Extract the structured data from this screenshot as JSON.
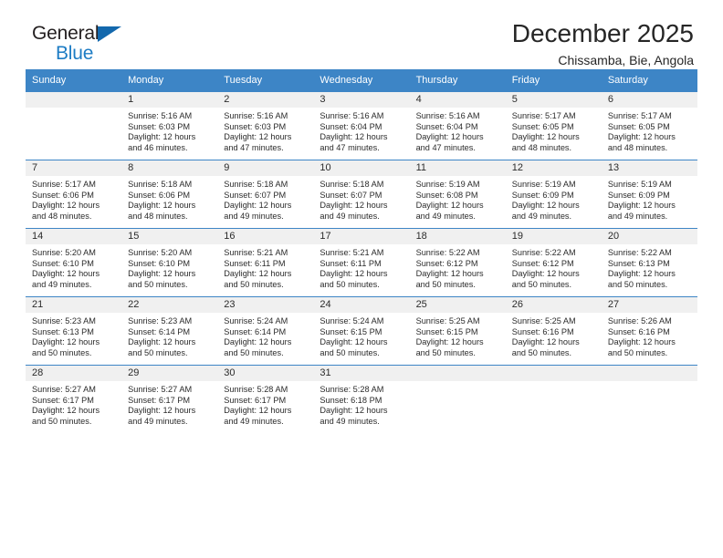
{
  "brand": {
    "line1": "General",
    "line2": "Blue",
    "triangle_color": "#1368ad",
    "blue_text_color": "#1d7cc4"
  },
  "header": {
    "title": "December 2025",
    "subtitle": "Chissamba, Bie, Angola"
  },
  "theme": {
    "header_blue": "#3d85c6",
    "daynum_band": "#f0f0f0",
    "text": "#2b2b2b"
  },
  "weekday_headers": [
    "Sunday",
    "Monday",
    "Tuesday",
    "Wednesday",
    "Thursday",
    "Friday",
    "Saturday"
  ],
  "weeks": [
    [
      {
        "day": "",
        "sunrise": "",
        "sunset": "",
        "daylight1": "",
        "daylight2": ""
      },
      {
        "day": "1",
        "sunrise": "Sunrise: 5:16 AM",
        "sunset": "Sunset: 6:03 PM",
        "daylight1": "Daylight: 12 hours",
        "daylight2": "and 46 minutes."
      },
      {
        "day": "2",
        "sunrise": "Sunrise: 5:16 AM",
        "sunset": "Sunset: 6:03 PM",
        "daylight1": "Daylight: 12 hours",
        "daylight2": "and 47 minutes."
      },
      {
        "day": "3",
        "sunrise": "Sunrise: 5:16 AM",
        "sunset": "Sunset: 6:04 PM",
        "daylight1": "Daylight: 12 hours",
        "daylight2": "and 47 minutes."
      },
      {
        "day": "4",
        "sunrise": "Sunrise: 5:16 AM",
        "sunset": "Sunset: 6:04 PM",
        "daylight1": "Daylight: 12 hours",
        "daylight2": "and 47 minutes."
      },
      {
        "day": "5",
        "sunrise": "Sunrise: 5:17 AM",
        "sunset": "Sunset: 6:05 PM",
        "daylight1": "Daylight: 12 hours",
        "daylight2": "and 48 minutes."
      },
      {
        "day": "6",
        "sunrise": "Sunrise: 5:17 AM",
        "sunset": "Sunset: 6:05 PM",
        "daylight1": "Daylight: 12 hours",
        "daylight2": "and 48 minutes."
      }
    ],
    [
      {
        "day": "7",
        "sunrise": "Sunrise: 5:17 AM",
        "sunset": "Sunset: 6:06 PM",
        "daylight1": "Daylight: 12 hours",
        "daylight2": "and 48 minutes."
      },
      {
        "day": "8",
        "sunrise": "Sunrise: 5:18 AM",
        "sunset": "Sunset: 6:06 PM",
        "daylight1": "Daylight: 12 hours",
        "daylight2": "and 48 minutes."
      },
      {
        "day": "9",
        "sunrise": "Sunrise: 5:18 AM",
        "sunset": "Sunset: 6:07 PM",
        "daylight1": "Daylight: 12 hours",
        "daylight2": "and 49 minutes."
      },
      {
        "day": "10",
        "sunrise": "Sunrise: 5:18 AM",
        "sunset": "Sunset: 6:07 PM",
        "daylight1": "Daylight: 12 hours",
        "daylight2": "and 49 minutes."
      },
      {
        "day": "11",
        "sunrise": "Sunrise: 5:19 AM",
        "sunset": "Sunset: 6:08 PM",
        "daylight1": "Daylight: 12 hours",
        "daylight2": "and 49 minutes."
      },
      {
        "day": "12",
        "sunrise": "Sunrise: 5:19 AM",
        "sunset": "Sunset: 6:09 PM",
        "daylight1": "Daylight: 12 hours",
        "daylight2": "and 49 minutes."
      },
      {
        "day": "13",
        "sunrise": "Sunrise: 5:19 AM",
        "sunset": "Sunset: 6:09 PM",
        "daylight1": "Daylight: 12 hours",
        "daylight2": "and 49 minutes."
      }
    ],
    [
      {
        "day": "14",
        "sunrise": "Sunrise: 5:20 AM",
        "sunset": "Sunset: 6:10 PM",
        "daylight1": "Daylight: 12 hours",
        "daylight2": "and 49 minutes."
      },
      {
        "day": "15",
        "sunrise": "Sunrise: 5:20 AM",
        "sunset": "Sunset: 6:10 PM",
        "daylight1": "Daylight: 12 hours",
        "daylight2": "and 50 minutes."
      },
      {
        "day": "16",
        "sunrise": "Sunrise: 5:21 AM",
        "sunset": "Sunset: 6:11 PM",
        "daylight1": "Daylight: 12 hours",
        "daylight2": "and 50 minutes."
      },
      {
        "day": "17",
        "sunrise": "Sunrise: 5:21 AM",
        "sunset": "Sunset: 6:11 PM",
        "daylight1": "Daylight: 12 hours",
        "daylight2": "and 50 minutes."
      },
      {
        "day": "18",
        "sunrise": "Sunrise: 5:22 AM",
        "sunset": "Sunset: 6:12 PM",
        "daylight1": "Daylight: 12 hours",
        "daylight2": "and 50 minutes."
      },
      {
        "day": "19",
        "sunrise": "Sunrise: 5:22 AM",
        "sunset": "Sunset: 6:12 PM",
        "daylight1": "Daylight: 12 hours",
        "daylight2": "and 50 minutes."
      },
      {
        "day": "20",
        "sunrise": "Sunrise: 5:22 AM",
        "sunset": "Sunset: 6:13 PM",
        "daylight1": "Daylight: 12 hours",
        "daylight2": "and 50 minutes."
      }
    ],
    [
      {
        "day": "21",
        "sunrise": "Sunrise: 5:23 AM",
        "sunset": "Sunset: 6:13 PM",
        "daylight1": "Daylight: 12 hours",
        "daylight2": "and 50 minutes."
      },
      {
        "day": "22",
        "sunrise": "Sunrise: 5:23 AM",
        "sunset": "Sunset: 6:14 PM",
        "daylight1": "Daylight: 12 hours",
        "daylight2": "and 50 minutes."
      },
      {
        "day": "23",
        "sunrise": "Sunrise: 5:24 AM",
        "sunset": "Sunset: 6:14 PM",
        "daylight1": "Daylight: 12 hours",
        "daylight2": "and 50 minutes."
      },
      {
        "day": "24",
        "sunrise": "Sunrise: 5:24 AM",
        "sunset": "Sunset: 6:15 PM",
        "daylight1": "Daylight: 12 hours",
        "daylight2": "and 50 minutes."
      },
      {
        "day": "25",
        "sunrise": "Sunrise: 5:25 AM",
        "sunset": "Sunset: 6:15 PM",
        "daylight1": "Daylight: 12 hours",
        "daylight2": "and 50 minutes."
      },
      {
        "day": "26",
        "sunrise": "Sunrise: 5:25 AM",
        "sunset": "Sunset: 6:16 PM",
        "daylight1": "Daylight: 12 hours",
        "daylight2": "and 50 minutes."
      },
      {
        "day": "27",
        "sunrise": "Sunrise: 5:26 AM",
        "sunset": "Sunset: 6:16 PM",
        "daylight1": "Daylight: 12 hours",
        "daylight2": "and 50 minutes."
      }
    ],
    [
      {
        "day": "28",
        "sunrise": "Sunrise: 5:27 AM",
        "sunset": "Sunset: 6:17 PM",
        "daylight1": "Daylight: 12 hours",
        "daylight2": "and 50 minutes."
      },
      {
        "day": "29",
        "sunrise": "Sunrise: 5:27 AM",
        "sunset": "Sunset: 6:17 PM",
        "daylight1": "Daylight: 12 hours",
        "daylight2": "and 49 minutes."
      },
      {
        "day": "30",
        "sunrise": "Sunrise: 5:28 AM",
        "sunset": "Sunset: 6:17 PM",
        "daylight1": "Daylight: 12 hours",
        "daylight2": "and 49 minutes."
      },
      {
        "day": "31",
        "sunrise": "Sunrise: 5:28 AM",
        "sunset": "Sunset: 6:18 PM",
        "daylight1": "Daylight: 12 hours",
        "daylight2": "and 49 minutes."
      },
      {
        "day": "",
        "sunrise": "",
        "sunset": "",
        "daylight1": "",
        "daylight2": ""
      },
      {
        "day": "",
        "sunrise": "",
        "sunset": "",
        "daylight1": "",
        "daylight2": ""
      },
      {
        "day": "",
        "sunrise": "",
        "sunset": "",
        "daylight1": "",
        "daylight2": ""
      }
    ]
  ]
}
